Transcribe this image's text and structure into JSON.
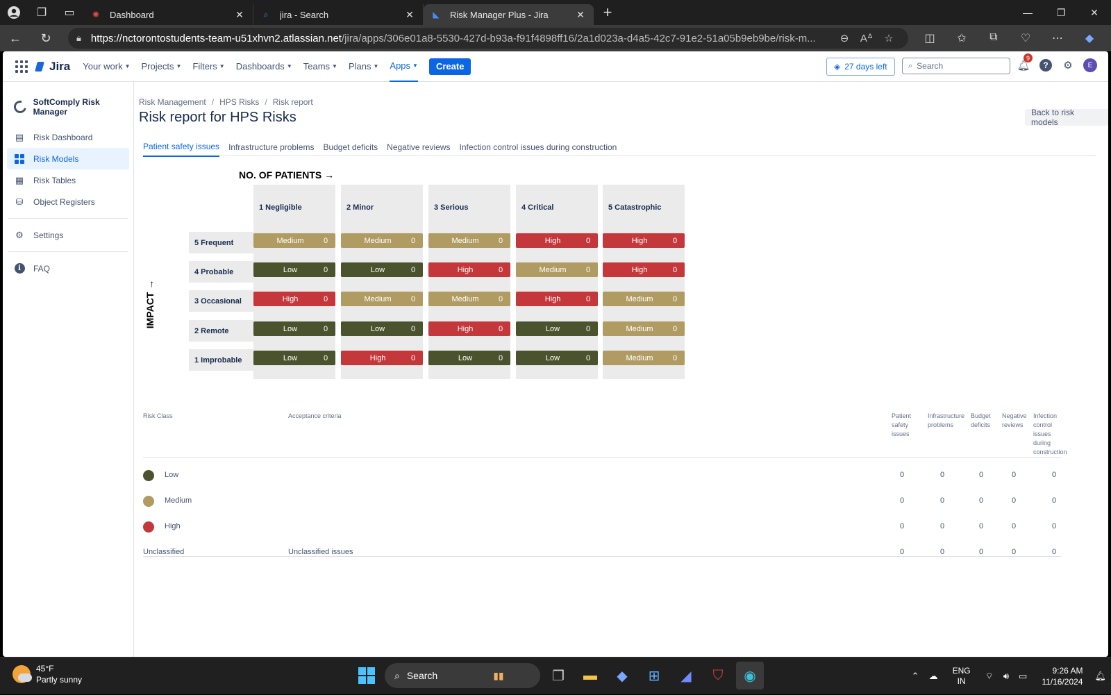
{
  "browser": {
    "tabs": [
      {
        "title": "Dashboard"
      },
      {
        "title": "jira - Search"
      },
      {
        "title": "Risk Manager Plus - Jira"
      }
    ],
    "url_host": "https://nctorontostudents-team-u51xhvn2.atlassian.net",
    "url_path": "/jira/apps/306e01a8-5530-427d-b93a-f91f4898ff16/2a1d023a-d4a5-42c7-91e2-51a05b9eb9be/risk-m..."
  },
  "jira_nav": {
    "logo": "Jira",
    "menu": [
      "Your work",
      "Projects",
      "Filters",
      "Dashboards",
      "Teams",
      "Plans",
      "Apps"
    ],
    "create": "Create",
    "trial": "27 days left",
    "search_placeholder": "Search",
    "notifications": "9",
    "avatar": "E"
  },
  "sidebar": {
    "app": "SoftComply Risk Manager",
    "items": [
      "Risk Dashboard",
      "Risk Models",
      "Risk Tables",
      "Object Registers",
      "Settings",
      "FAQ"
    ]
  },
  "breadcrumb": [
    "Risk Management",
    "HPS Risks",
    "Risk report"
  ],
  "title": "Risk report for HPS Risks",
  "back_button": "Back to risk models",
  "tabs": [
    "Patient safety issues",
    "Infrastructure problems",
    "Budget deficits",
    "Negative reviews",
    "Infection control issues during construction"
  ],
  "matrix": {
    "x_label": "NO. OF PATIENTS →",
    "y_label": "IMPACT →",
    "columns": [
      "1 Negligible",
      "2 Minor",
      "3 Serious",
      "4 Critical",
      "5 Catastrophic"
    ],
    "rows": [
      {
        "label": "5 Frequent",
        "cells": [
          [
            "Medium",
            "0"
          ],
          [
            "Medium",
            "0"
          ],
          [
            "Medium",
            "0"
          ],
          [
            "High",
            "0"
          ],
          [
            "High",
            "0"
          ]
        ]
      },
      {
        "label": "4 Probable",
        "cells": [
          [
            "Low",
            "0"
          ],
          [
            "Low",
            "0"
          ],
          [
            "High",
            "0"
          ],
          [
            "Medium",
            "0"
          ],
          [
            "High",
            "0"
          ]
        ]
      },
      {
        "label": "3 Occasional",
        "cells": [
          [
            "High",
            "0"
          ],
          [
            "Medium",
            "0"
          ],
          [
            "Medium",
            "0"
          ],
          [
            "High",
            "0"
          ],
          [
            "Medium",
            "0"
          ]
        ]
      },
      {
        "label": "2 Remote",
        "cells": [
          [
            "Low",
            "0"
          ],
          [
            "Low",
            "0"
          ],
          [
            "High",
            "0"
          ],
          [
            "Low",
            "0"
          ],
          [
            "Medium",
            "0"
          ]
        ]
      },
      {
        "label": "1 Improbable",
        "cells": [
          [
            "Low",
            "0"
          ],
          [
            "High",
            "0"
          ],
          [
            "Low",
            "0"
          ],
          [
            "Low",
            "0"
          ],
          [
            "Medium",
            "0"
          ]
        ]
      }
    ],
    "colors": {
      "Low": "#4b532e",
      "Medium": "#b09b62",
      "High": "#c4383c"
    }
  },
  "risk_table": {
    "headers": [
      "Risk Class",
      "Acceptance criteria",
      "Patient\nsafety\nissues",
      "Infrastructure\nproblems",
      "Budget\ndeficits",
      "Negative\nreviews",
      "Infection\ncontrol\nissues\nduring\nconstruction"
    ],
    "rows": [
      {
        "class": "Low",
        "criteria": "",
        "values": [
          "0",
          "0",
          "0",
          "0",
          "0"
        ],
        "color": "#4b532e"
      },
      {
        "class": "Medium",
        "criteria": "",
        "values": [
          "0",
          "0",
          "0",
          "0",
          "0"
        ],
        "color": "#b09b62"
      },
      {
        "class": "High",
        "criteria": "",
        "values": [
          "0",
          "0",
          "0",
          "0",
          "0"
        ],
        "color": "#c4383c"
      },
      {
        "class": "Unclassified",
        "criteria": "Unclassified issues",
        "values": [
          "0",
          "0",
          "0",
          "0",
          "0"
        ],
        "color": ""
      }
    ]
  },
  "taskbar": {
    "temp": "45°F",
    "weather": "Partly sunny",
    "search": "Search",
    "lang1": "ENG",
    "lang2": "IN",
    "time": "9:26 AM",
    "date": "11/16/2024"
  }
}
